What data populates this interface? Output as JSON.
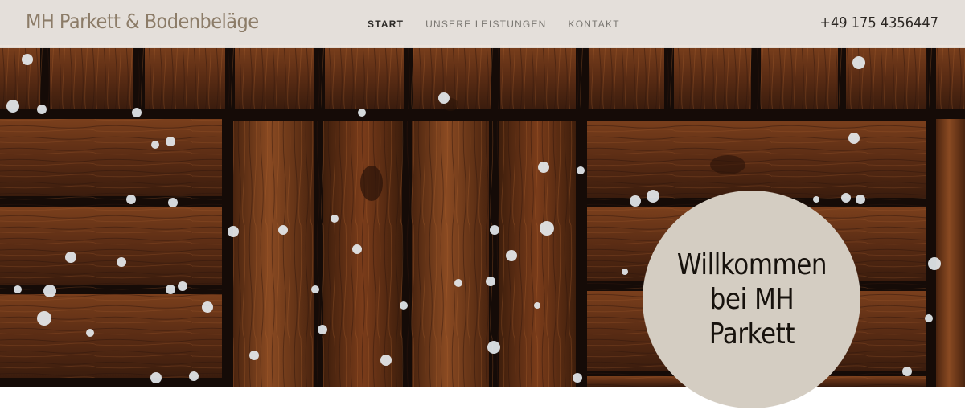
{
  "header": {
    "logo": "MH Parkett & Bodenbeläge",
    "nav": [
      {
        "label": "START",
        "active": true
      },
      {
        "label": "UNSERE LEISTUNGEN",
        "active": false
      },
      {
        "label": "KONTAKT",
        "active": false
      }
    ],
    "phone": "+49 175 4356447"
  },
  "hero": {
    "welcome_lines": [
      "Willkommen",
      "bei MH",
      "Parkett"
    ]
  },
  "colors": {
    "header_bg": "#f4f0eb",
    "logo": "#8c7c68",
    "circle": "#d4cdc2",
    "wood": "#6b3518"
  }
}
